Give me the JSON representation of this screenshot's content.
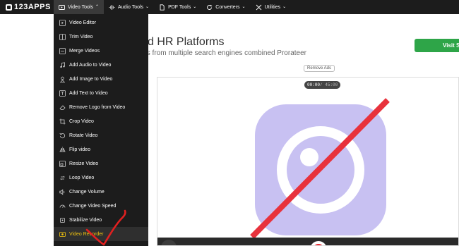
{
  "logo": {
    "text": "123APPS"
  },
  "nav": {
    "items": [
      {
        "label": "Video Tools",
        "icon": "video-icon",
        "active": true
      },
      {
        "label": "Audio Tools",
        "icon": "waveform-icon",
        "active": false
      },
      {
        "label": "PDF Tools",
        "icon": "document-icon",
        "active": false
      },
      {
        "label": "Converters",
        "icon": "refresh-icon",
        "active": false
      },
      {
        "label": "Utilities",
        "icon": "tools-icon",
        "active": false
      }
    ]
  },
  "page": {
    "title": "d HR Platforms",
    "subtitle": "ts from multiple search engines combined Prorateer",
    "visit_button": "Visit Si",
    "remove_ads": "Remove Ads"
  },
  "video": {
    "timer_current": "00:00",
    "timer_total": "/ 45:00"
  },
  "dropdown": {
    "items": [
      {
        "label": "Video Editor",
        "icon": "play-square-icon"
      },
      {
        "label": "Trim Video",
        "icon": "trim-icon"
      },
      {
        "label": "Merge Videos",
        "icon": "merge-icon"
      },
      {
        "label": "Add Audio to Video",
        "icon": "music-note-icon"
      },
      {
        "label": "Add Image to Video",
        "icon": "image-icon"
      },
      {
        "label": "Add Text to Video",
        "icon": "text-icon"
      },
      {
        "label": "Remove Logo from Video",
        "icon": "eraser-icon"
      },
      {
        "label": "Crop Video",
        "icon": "crop-icon"
      },
      {
        "label": "Rotate Video",
        "icon": "rotate-icon"
      },
      {
        "label": "Flip video",
        "icon": "flip-icon"
      },
      {
        "label": "Resize Video",
        "icon": "resize-icon"
      },
      {
        "label": "Loop Video",
        "icon": "loop-icon"
      },
      {
        "label": "Change Volume",
        "icon": "volume-icon"
      },
      {
        "label": "Change Video Speed",
        "icon": "speedometer-icon"
      },
      {
        "label": "Stabilize Video",
        "icon": "stabilize-icon"
      },
      {
        "label": "Video Recorder",
        "icon": "record-icon",
        "selected": true
      }
    ]
  },
  "colors": {
    "nav_bg": "#1c1c1c",
    "selected_text": "#f1c40f",
    "visit_button": "#2ea548",
    "camera_icon": "#c8c1f2",
    "slash_red": "#e8323c",
    "checkmark_red": "#e02020"
  }
}
